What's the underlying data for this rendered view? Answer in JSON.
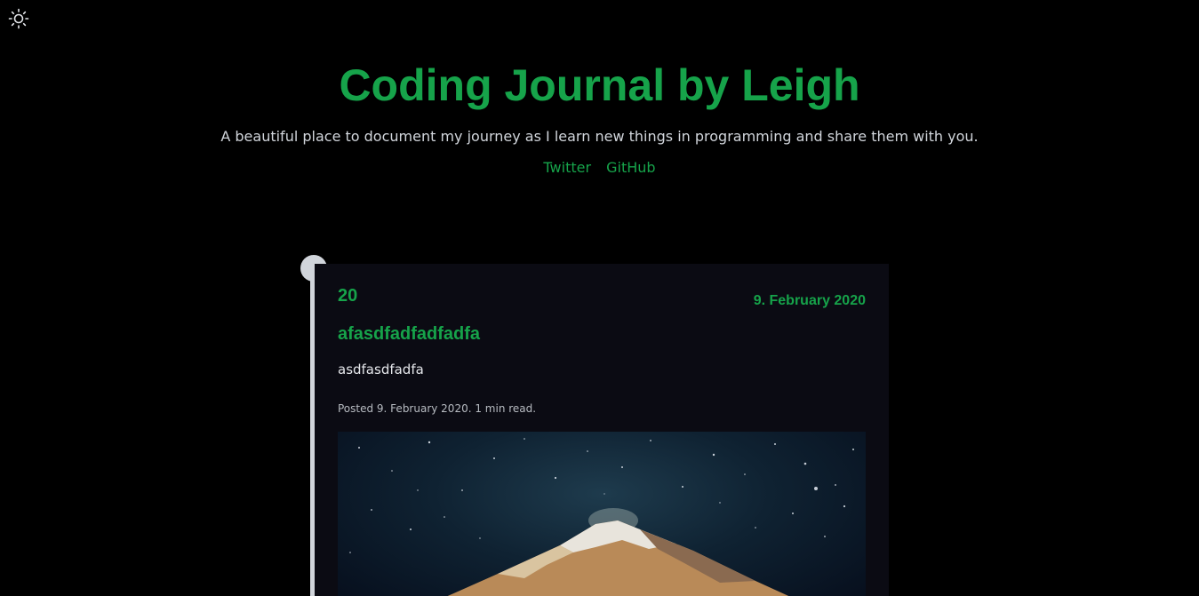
{
  "header": {
    "title": "Coding Journal by Leigh",
    "description": "A beautiful place to document my journey as I learn new things in programming and share them with you.",
    "links": [
      {
        "label": "Twitter"
      },
      {
        "label": "GitHub"
      }
    ]
  },
  "theme_toggle": {
    "icon": "sun-icon"
  },
  "post": {
    "number": "20",
    "date": "9. February 2020",
    "title": "afasdfadfadfadfa",
    "excerpt": "asdfasdfadfa",
    "meta": "Posted 9. February 2020. 1 min read.",
    "image_subject": "snowy volcano under starry night sky"
  },
  "colors": {
    "accent": "#16a34a",
    "background": "#000000",
    "card": "#0b0b13",
    "timeline": "#d1d5db"
  }
}
